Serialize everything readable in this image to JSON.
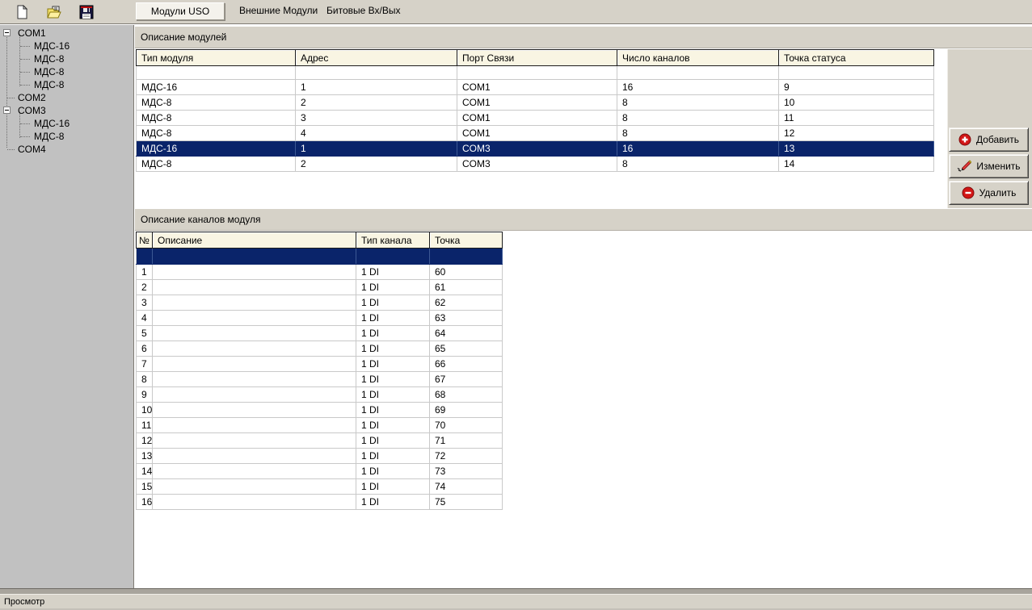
{
  "toolbar": {
    "icons": [
      {
        "name": "new-document-icon"
      },
      {
        "name": "open-file-icon"
      },
      {
        "name": "save-icon"
      }
    ]
  },
  "tabs": [
    {
      "label": "Модули USO",
      "active": true
    },
    {
      "label": "Внешние Модули",
      "active": false
    },
    {
      "label": "Битовые Вх/Вых",
      "active": false
    }
  ],
  "tree": {
    "items": [
      {
        "label": "COM1",
        "level": 0,
        "expanded": true
      },
      {
        "label": "МДС-16",
        "level": 1
      },
      {
        "label": "МДС-8",
        "level": 1
      },
      {
        "label": "МДС-8",
        "level": 1
      },
      {
        "label": "МДС-8",
        "level": 1
      },
      {
        "label": "COM2",
        "level": 0
      },
      {
        "label": "COM3",
        "level": 0,
        "expanded": true
      },
      {
        "label": "МДС-16",
        "level": 1
      },
      {
        "label": "МДС-8",
        "level": 1
      },
      {
        "label": "COM4",
        "level": 0
      }
    ]
  },
  "modules_section": {
    "title": "Описание модулей",
    "columns": [
      "Тип модуля",
      "Адрес",
      "Порт Связи",
      "Число каналов",
      "Точка статуса"
    ],
    "rows": [
      [
        "МДС-16",
        "1",
        "COM1",
        "16",
        "9"
      ],
      [
        "МДС-8",
        "2",
        "COM1",
        "8",
        "10"
      ],
      [
        "МДС-8",
        "3",
        "COM1",
        "8",
        "11"
      ],
      [
        "МДС-8",
        "4",
        "COM1",
        "8",
        "12"
      ],
      [
        "МДС-16",
        "1",
        "COM3",
        "16",
        "13"
      ],
      [
        "МДС-8",
        "2",
        "COM3",
        "8",
        "14"
      ]
    ],
    "selected_row_index": 4
  },
  "actions": {
    "add_label": "Добавить",
    "edit_label": "Изменить",
    "delete_label": "Удалить"
  },
  "channels_section": {
    "title": "Описание каналов модуля",
    "columns": [
      "№",
      "Описание",
      "Тип канала",
      "Точка"
    ],
    "rows": [
      [
        "1",
        "",
        "1 DI",
        "60"
      ],
      [
        "2",
        "",
        "1 DI",
        "61"
      ],
      [
        "3",
        "",
        "1 DI",
        "62"
      ],
      [
        "4",
        "",
        "1 DI",
        "63"
      ],
      [
        "5",
        "",
        "1 DI",
        "64"
      ],
      [
        "6",
        "",
        "1 DI",
        "65"
      ],
      [
        "7",
        "",
        "1 DI",
        "66"
      ],
      [
        "8",
        "",
        "1 DI",
        "67"
      ],
      [
        "9",
        "",
        "1 DI",
        "68"
      ],
      [
        "10",
        "",
        "1 DI",
        "69"
      ],
      [
        "11",
        "",
        "1 DI",
        "70"
      ],
      [
        "12",
        "",
        "1 DI",
        "71"
      ],
      [
        "13",
        "",
        "1 DI",
        "72"
      ],
      [
        "14",
        "",
        "1 DI",
        "73"
      ],
      [
        "15",
        "",
        "1 DI",
        "74"
      ],
      [
        "16",
        "",
        "1 DI",
        "75"
      ]
    ]
  },
  "status_bar": {
    "text": "Просмотр"
  },
  "colors": {
    "selection": "#0a246a",
    "chrome": "#d6d2c8",
    "header_cell": "#f9f5e3",
    "accent_red": "#d21616"
  }
}
